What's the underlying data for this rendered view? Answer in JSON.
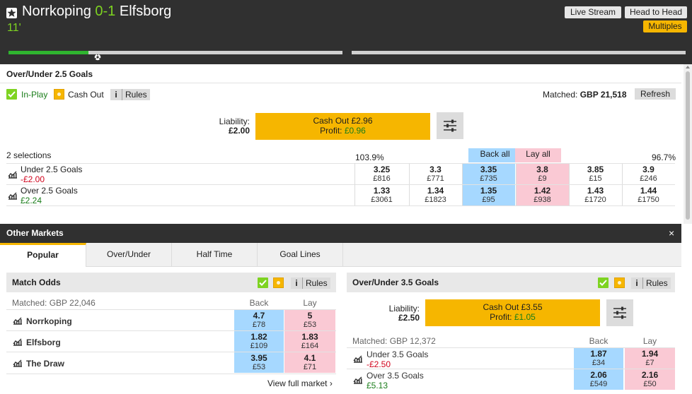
{
  "header": {
    "home": "Norrkoping",
    "score": "0-1",
    "away": "Elfsborg",
    "clock": "11'",
    "live_stream": "Live Stream",
    "head_to_head": "Head to Head",
    "multiples": "Multiples",
    "progress_first_half": 0.24,
    "progress_second_half": 0.0
  },
  "colors": {
    "accent": "#f6b600",
    "back": "#a6d8ff",
    "lay": "#fac9d4",
    "green": "#7ed321",
    "header_bg": "#303030"
  },
  "main_market": {
    "title": "Over/Under 2.5 Goals",
    "in_play": "In-Play",
    "cash_out": "Cash Out",
    "rules": "Rules",
    "rules_icon": "i",
    "matched_label": "Matched:",
    "matched_value": "GBP 21,518",
    "refresh": "Refresh",
    "liability_label": "Liability:",
    "liability_value": "£2.00",
    "cashout_label": "Cash Out £2.96",
    "profit_label": "Profit:",
    "profit_value": "£0.96",
    "selections_count": "2 selections",
    "back_overround": "103.9%",
    "lay_overround": "96.7%",
    "back_all": "Back all",
    "lay_all": "Lay all",
    "runners": [
      {
        "name": "Under 2.5 Goals",
        "pl": "-£2.00",
        "prices": [
          {
            "p": "3.25",
            "v": "£816"
          },
          {
            "p": "3.3",
            "v": "£771"
          },
          {
            "p": "3.35",
            "v": "£735"
          },
          {
            "p": "3.8",
            "v": "£9"
          },
          {
            "p": "3.85",
            "v": "£15"
          },
          {
            "p": "3.9",
            "v": "£246"
          }
        ]
      },
      {
        "name": "Over 2.5 Goals",
        "pl": "£2.24",
        "prices": [
          {
            "p": "1.33",
            "v": "£3061"
          },
          {
            "p": "1.34",
            "v": "£1823"
          },
          {
            "p": "1.35",
            "v": "£95"
          },
          {
            "p": "1.42",
            "v": "£938"
          },
          {
            "p": "1.43",
            "v": "£1720"
          },
          {
            "p": "1.44",
            "v": "£1750"
          }
        ]
      }
    ]
  },
  "other_markets": {
    "title": "Other Markets",
    "close": "×",
    "tabs": [
      "Popular",
      "Over/Under",
      "Half Time",
      "Goal Lines"
    ],
    "match_odds": {
      "title": "Match Odds",
      "rules": "Rules",
      "rules_icon": "i",
      "matched": "Matched: GBP 22,046",
      "back": "Back",
      "lay": "Lay",
      "runners": [
        {
          "name": "Norrkoping",
          "bp": "4.7",
          "bv": "£78",
          "lp": "5",
          "lv": "£53"
        },
        {
          "name": "Elfsborg",
          "bp": "1.82",
          "bv": "£109",
          "lp": "1.83",
          "lv": "£164"
        },
        {
          "name": "The Draw",
          "bp": "3.95",
          "bv": "£53",
          "lp": "4.1",
          "lv": "£71"
        }
      ],
      "view_full": "View full market"
    },
    "ou35": {
      "title": "Over/Under 3.5 Goals",
      "rules": "Rules",
      "rules_icon": "i",
      "liability_label": "Liability:",
      "liability_value": "£2.50",
      "cashout_label": "Cash Out £3.55",
      "profit_label": "Profit:",
      "profit_value": "£1.05",
      "matched": "Matched: GBP 12,372",
      "back": "Back",
      "lay": "Lay",
      "runners": [
        {
          "name": "Under 3.5 Goals",
          "pl": "-£2.50",
          "bp": "1.87",
          "bv": "£34",
          "lp": "1.94",
          "lv": "£7"
        },
        {
          "name": "Over 3.5 Goals",
          "pl": "£5.13",
          "bp": "2.06",
          "bv": "£549",
          "lp": "2.16",
          "lv": "£50"
        }
      ]
    }
  }
}
